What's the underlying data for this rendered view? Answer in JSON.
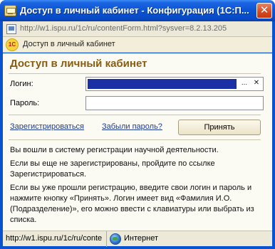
{
  "window": {
    "title": "Доступ в личный кабинет - Конфигурация (1С:П..."
  },
  "address": {
    "url": "http://w1.ispu.ru/1c/ru/contentForm.html?sysver=8.2.13.205"
  },
  "app": {
    "logo_text": "1С",
    "name": "Доступ в личный кабинет"
  },
  "form": {
    "heading": "Доступ в личный кабинет",
    "login_label": "Логин:",
    "password_label": "Пароль:",
    "choose_button": "...",
    "clear_button": "✕",
    "register_link": "Зарегистрироваться",
    "forgot_link": "Забыли пароль?",
    "accept_button": "Принять"
  },
  "info": {
    "paragraph1": "Вы вошли в систему регистрации научной деятельности.",
    "paragraph2": "Если вы еще не зарегистрированы, пройдите по ссылке Зарегистрироваться.",
    "paragraph3": "Если вы уже прошли регистрацию, введите свои логин и пароль и нажмите кнопку «Принять». Логин имеет вид «Фамилия И.О. (Подразделение)», его можно ввести с клавиатуры или выбрать из списка."
  },
  "status": {
    "url": "http://w1.ispu.ru/1c/ru/conte",
    "zone": "Интернет"
  }
}
